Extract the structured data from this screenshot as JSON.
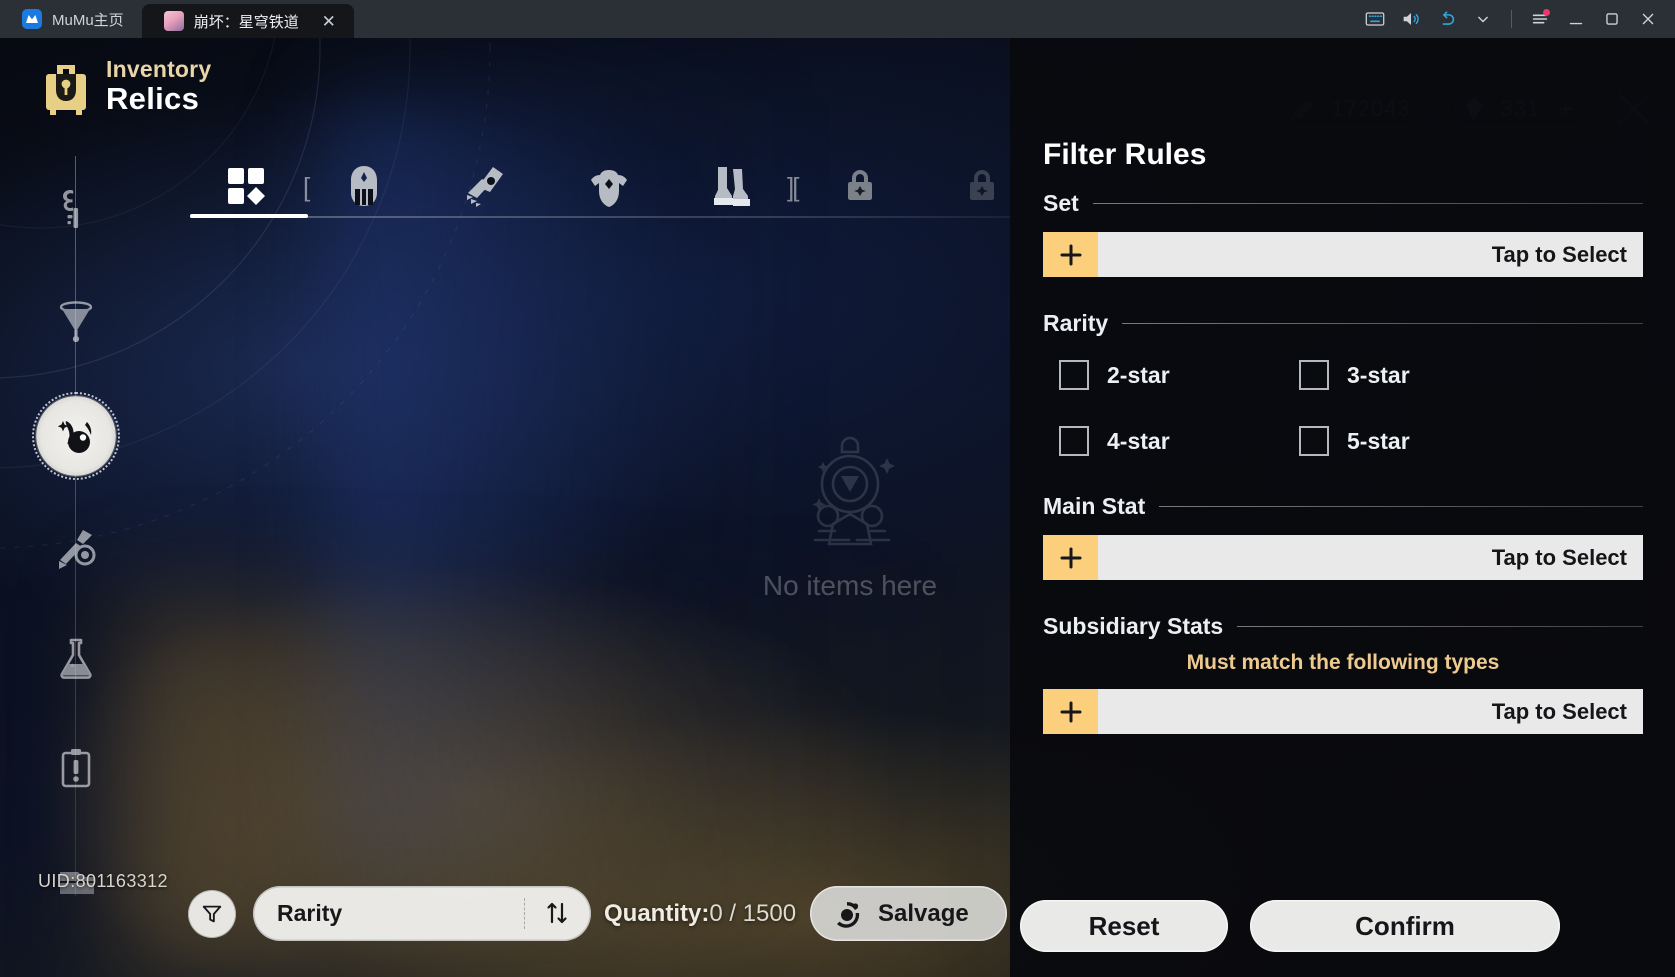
{
  "titlebar": {
    "home_tab": "MuMu主页",
    "active_tab": "崩坏：星穹铁道",
    "close_glyph": "✕",
    "icons": [
      {
        "name": "keyboard-icon"
      },
      {
        "name": "volume-icon"
      },
      {
        "name": "undo-icon"
      },
      {
        "name": "chevron-down-icon"
      },
      {
        "name": "menu-icon"
      },
      {
        "name": "minimize-icon"
      },
      {
        "name": "maximize-icon"
      },
      {
        "name": "window-close-icon"
      }
    ]
  },
  "inventory": {
    "title": "Inventory",
    "subtitle": "Relics",
    "uid": "UID:801163312"
  },
  "sidebar": {
    "items": [
      {
        "name": "relic-icon",
        "label": "Relics",
        "selected": true
      },
      {
        "name": "light-cone-icon",
        "label": "Light Cones",
        "selected": false
      },
      {
        "name": "consumable-flask-icon",
        "label": "Consumables",
        "selected": false
      },
      {
        "name": "mission-item-icon",
        "label": "Mission Items",
        "selected": false
      },
      {
        "name": "other-materials-icon",
        "label": "Other Materials",
        "selected": false
      },
      {
        "name": "key-icon",
        "label": "Upgrade Materials",
        "selected": false
      },
      {
        "name": "funnel-icon",
        "label": "Synthesize",
        "selected": false
      }
    ]
  },
  "tabs": [
    {
      "name": "tab-all-relics",
      "icon": "grid-icon",
      "selected": true
    },
    {
      "name": "tab-head",
      "icon": "helmet-icon",
      "selected": false
    },
    {
      "name": "tab-hands",
      "icon": "gloves-icon",
      "selected": false
    },
    {
      "name": "tab-body",
      "icon": "chest-armor-icon",
      "selected": false
    },
    {
      "name": "tab-feet",
      "icon": "boots-icon",
      "selected": false
    },
    {
      "name": "tab-planar-sphere",
      "icon": "lock-icon",
      "selected": false
    },
    {
      "name": "tab-link-rope",
      "icon": "lock-icon",
      "selected": false
    }
  ],
  "currency": [
    {
      "name": "credit-counter",
      "icon": "credit-icon",
      "value": "172043"
    },
    {
      "name": "stellar-jade-counter",
      "icon": "stellar-jade-icon",
      "value": "331",
      "plus": "+"
    }
  ],
  "close_button": "✕",
  "empty_state": {
    "icon": "empty-box-icon",
    "text": "No items here"
  },
  "bottom_bar": {
    "filter_icon": "funnel-filter-icon",
    "sort_label": "Rarity",
    "sort_icon": "sort-arrows-icon",
    "quantity_label": "Quantity:",
    "quantity_value": "0 / 1500",
    "salvage_icon": "salvage-icon",
    "salvage_label": "Salvage"
  },
  "filter_panel": {
    "title": "Filter Rules",
    "sections": {
      "set": {
        "heading": "Set",
        "select_placeholder": "Tap to Select",
        "plus_icon": "plus-icon"
      },
      "rarity": {
        "heading": "Rarity",
        "options": [
          {
            "label": "2-star",
            "checked": false
          },
          {
            "label": "3-star",
            "checked": false
          },
          {
            "label": "4-star",
            "checked": false
          },
          {
            "label": "5-star",
            "checked": false
          }
        ]
      },
      "main_stat": {
        "heading": "Main Stat",
        "select_placeholder": "Tap to Select",
        "plus_icon": "plus-icon"
      },
      "subsidiary_stats": {
        "heading": "Subsidiary Stats",
        "note": "Must match the following types",
        "select_placeholder": "Tap to Select",
        "plus_icon": "plus-icon"
      }
    },
    "reset_label": "Reset",
    "confirm_label": "Confirm"
  },
  "colors": {
    "accent_gold": "#fbcf7c",
    "note_gold": "#efca8e",
    "title_gold": "#e8d5a8",
    "panel_bg": "#0a0b0f",
    "button_light": "#e9e9e7"
  }
}
